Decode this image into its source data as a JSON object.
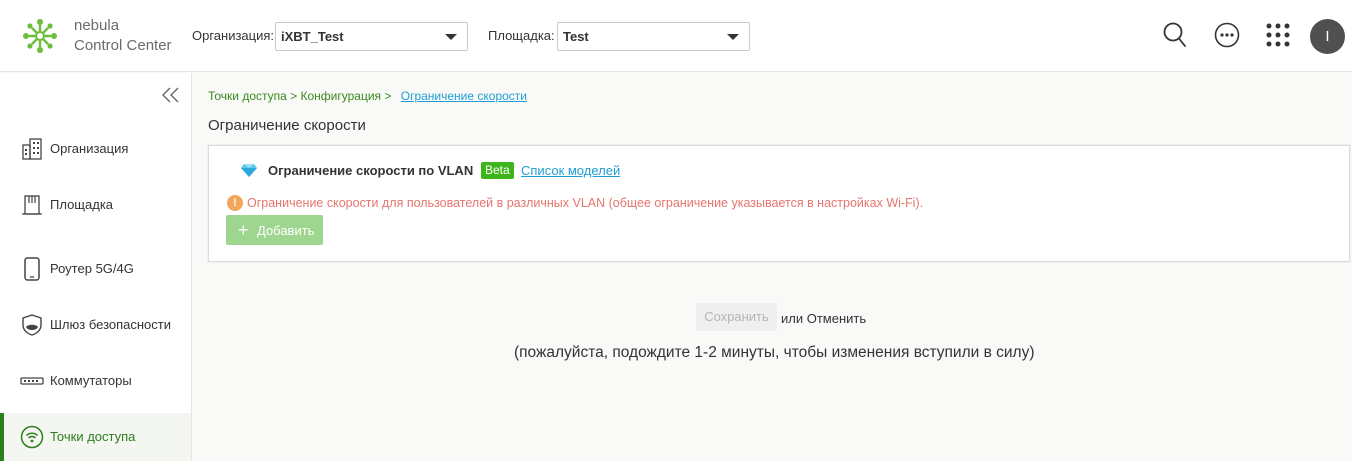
{
  "app": {
    "logo_line1": "nebula",
    "logo_line2": "Control Center"
  },
  "header": {
    "org_label": "Организация:",
    "org_value": "iXBT_Test",
    "site_label": "Площадка:",
    "site_value": "Test",
    "avatar_initial": "I"
  },
  "sidebar": {
    "items": [
      {
        "label": "Организация",
        "icon": "building-icon"
      },
      {
        "label": "Площадка",
        "icon": "site-icon"
      },
      {
        "label": "Роутер 5G/4G",
        "icon": "phone-router-icon"
      },
      {
        "label": "Шлюз безопасности",
        "icon": "shield-icon"
      },
      {
        "label": "Коммутаторы",
        "icon": "switch-icon"
      },
      {
        "label": "Точки доступа",
        "icon": "wifi-icon",
        "active": true
      }
    ]
  },
  "breadcrumb": {
    "part1": "Точки доступа",
    "sep1": " > ",
    "part2": "Конфигурация",
    "sep2": " > ",
    "current": "Ограничение скорости"
  },
  "page": {
    "title": "Ограничение скорости"
  },
  "card": {
    "title": "Ограничение скорости по VLAN",
    "badge": "Beta",
    "models_link": "Список моделей",
    "warning": "Ограничение скорости для пользователей в различных VLAN (общее ограничение указывается в настройках Wi-Fi).",
    "add_label": "Добавить"
  },
  "footer": {
    "save_label": "Сохранить",
    "or_cancel": "или Отменить",
    "wait_note": "(пожалуйста, подождите 1-2 минуты, чтобы изменения вступили в силу)"
  },
  "colors": {
    "brand_green": "#3db51b",
    "active_green": "#2e7d1e",
    "link_blue": "#1f9fd6",
    "warning_red": "#e6756e"
  }
}
